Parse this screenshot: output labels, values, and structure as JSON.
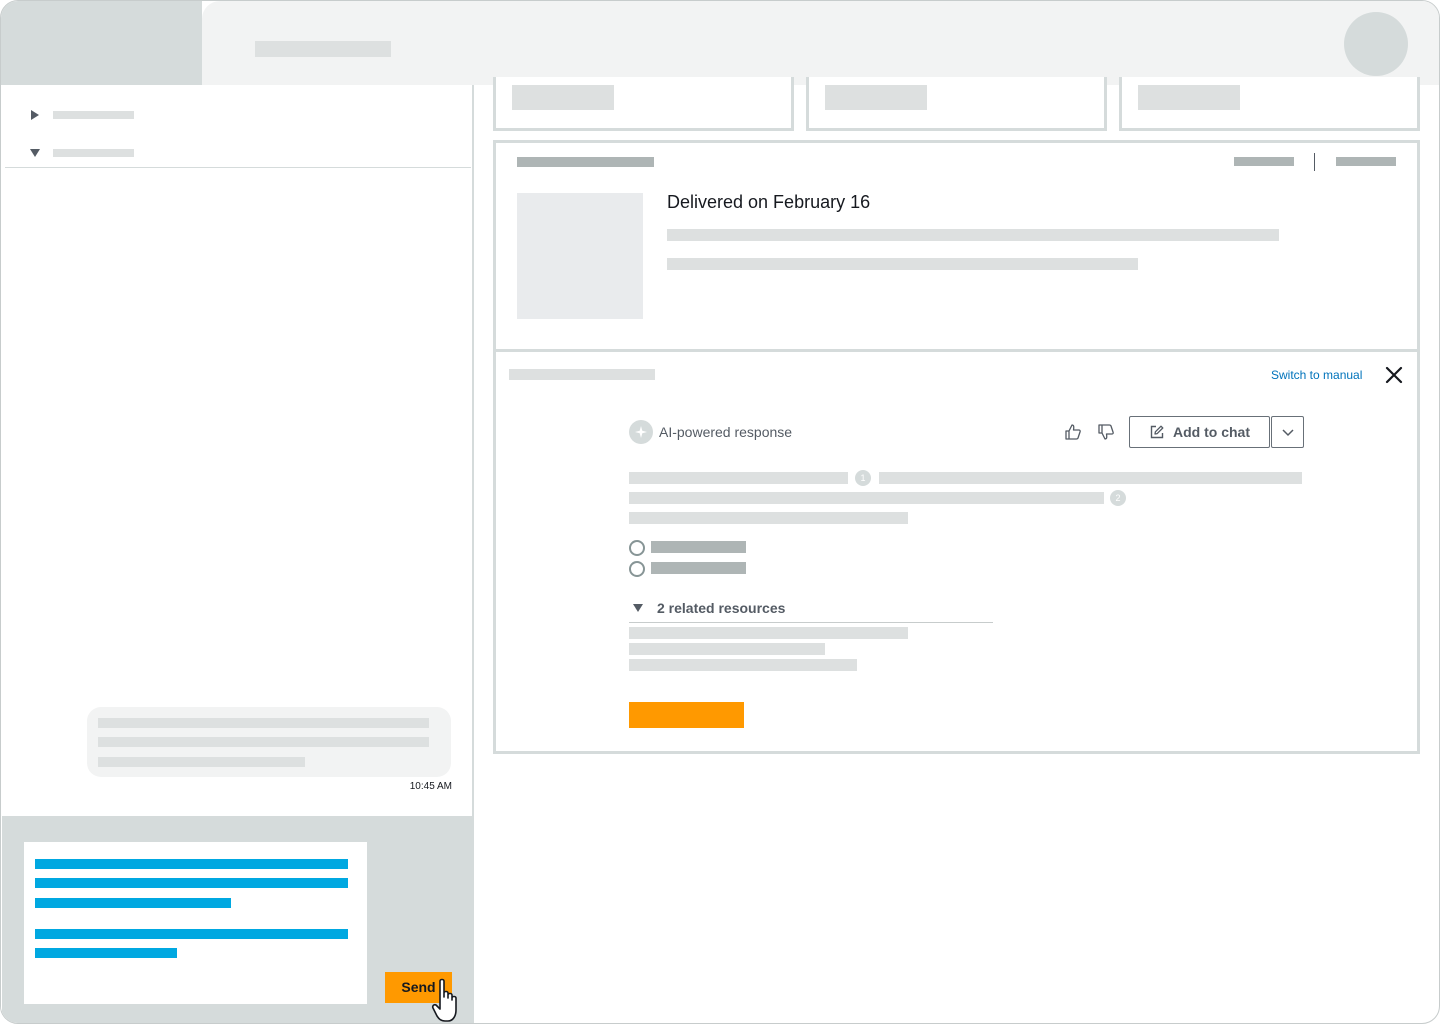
{
  "main": {
    "order_card": {
      "delivery_status": "Delivered on February 16"
    },
    "assistant_panel": {
      "switch_link": "Switch to manual",
      "ai_label": "AI-powered response",
      "add_to_chat_label": "Add to chat",
      "citations": [
        "1",
        "2"
      ],
      "related_resources_label": "2 related resources"
    }
  },
  "chat": {
    "message_timestamp": "10:45 AM",
    "send_label": "Send"
  },
  "colors": {
    "accent_orange": "#ff9900",
    "draft_text_blue": "#00a8e1",
    "link_blue": "#0073bb",
    "placeholder_gray": "#dde0e0"
  },
  "icons": [
    "caret-right-icon",
    "caret-down-icon",
    "close-icon",
    "sparkle-icon",
    "thumbs-up-icon",
    "thumbs-down-icon",
    "edit-icon",
    "chevron-down-icon",
    "pointer-cursor-icon"
  ]
}
